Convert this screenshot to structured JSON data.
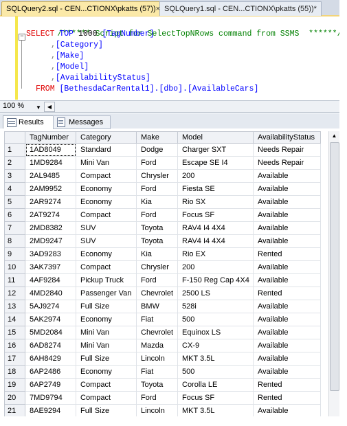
{
  "tabs": {
    "active_label": "SQLQuery2.sql - CEN...CTIONX\\pkatts (57))",
    "active_close": "×",
    "inactive_label": "SQLQuery1.sql - CEN...CTIONX\\pkatts (55))*"
  },
  "editor": {
    "comment": "/****** Script for SelectTopNRows command from SSMS  ******/",
    "select_kw": "SELECT",
    "top_kw": "TOP",
    "top_n": "1000",
    "cols": [
      "[TagNumber]",
      "[Category]",
      "[Make]",
      "[Model]",
      "[AvailabilityStatus]"
    ],
    "from_kw": "FROM",
    "from_target": "[BethesdaCarRental1].[dbo].[AvailableCars]"
  },
  "zoom": {
    "value": "100 %"
  },
  "results_tabs": {
    "results": "Results",
    "messages": "Messages"
  },
  "grid": {
    "headers": [
      "TagNumber",
      "Category",
      "Make",
      "Model",
      "AvailabilityStatus"
    ],
    "rows": [
      [
        "1",
        "1AD8049",
        "Standard",
        "Dodge",
        "Charger SXT",
        "Needs Repair"
      ],
      [
        "2",
        "1MD9284",
        "Mini Van",
        "Ford",
        "Escape SE I4",
        "Needs Repair"
      ],
      [
        "3",
        "2AL9485",
        "Compact",
        "Chrysler",
        "200",
        "Available"
      ],
      [
        "4",
        "2AM9952",
        "Economy",
        "Ford",
        "Fiesta SE",
        "Available"
      ],
      [
        "5",
        "2AR9274",
        "Economy",
        "Kia",
        "Rio SX",
        "Available"
      ],
      [
        "6",
        "2AT9274",
        "Compact",
        "Ford",
        "Focus SF",
        "Available"
      ],
      [
        "7",
        "2MD8382",
        "SUV",
        "Toyota",
        "RAV4 I4 4X4",
        "Available"
      ],
      [
        "8",
        "2MD9247",
        "SUV",
        "Toyota",
        "RAV4 I4 4X4",
        "Available"
      ],
      [
        "9",
        "3AD9283",
        "Economy",
        "Kia",
        "Rio EX",
        "Rented"
      ],
      [
        "10",
        "3AK7397",
        "Compact",
        "Chrysler",
        "200",
        "Available"
      ],
      [
        "11",
        "4AF9284",
        "Pickup Truck",
        "Ford",
        "F-150 Reg Cap 4X4",
        "Available"
      ],
      [
        "12",
        "4MD2840",
        "Passenger Van",
        "Chevrolet",
        "2500 LS",
        "Rented"
      ],
      [
        "13",
        "5AJ9274",
        "Full Size",
        "BMW",
        "528i",
        "Available"
      ],
      [
        "14",
        "5AK2974",
        "Economy",
        "Fiat",
        "500",
        "Available"
      ],
      [
        "15",
        "5MD2084",
        "Mini Van",
        "Chevrolet",
        "Equinox LS",
        "Available"
      ],
      [
        "16",
        "6AD8274",
        "Mini Van",
        "Mazda",
        "CX-9",
        "Available"
      ],
      [
        "17",
        "6AH8429",
        "Full Size",
        "Lincoln",
        "MKT 3.5L",
        "Available"
      ],
      [
        "18",
        "6AP2486",
        "Economy",
        "Fiat",
        "500",
        "Available"
      ],
      [
        "19",
        "6AP2749",
        "Compact",
        "Toyota",
        "Corolla LE",
        "Rented"
      ],
      [
        "20",
        "7MD9794",
        "Compact",
        "Ford",
        "Focus SF",
        "Rented"
      ],
      [
        "21",
        "8AE9294",
        "Full Size",
        "Lincoln",
        "MKT 3.5L",
        "Available"
      ]
    ]
  }
}
